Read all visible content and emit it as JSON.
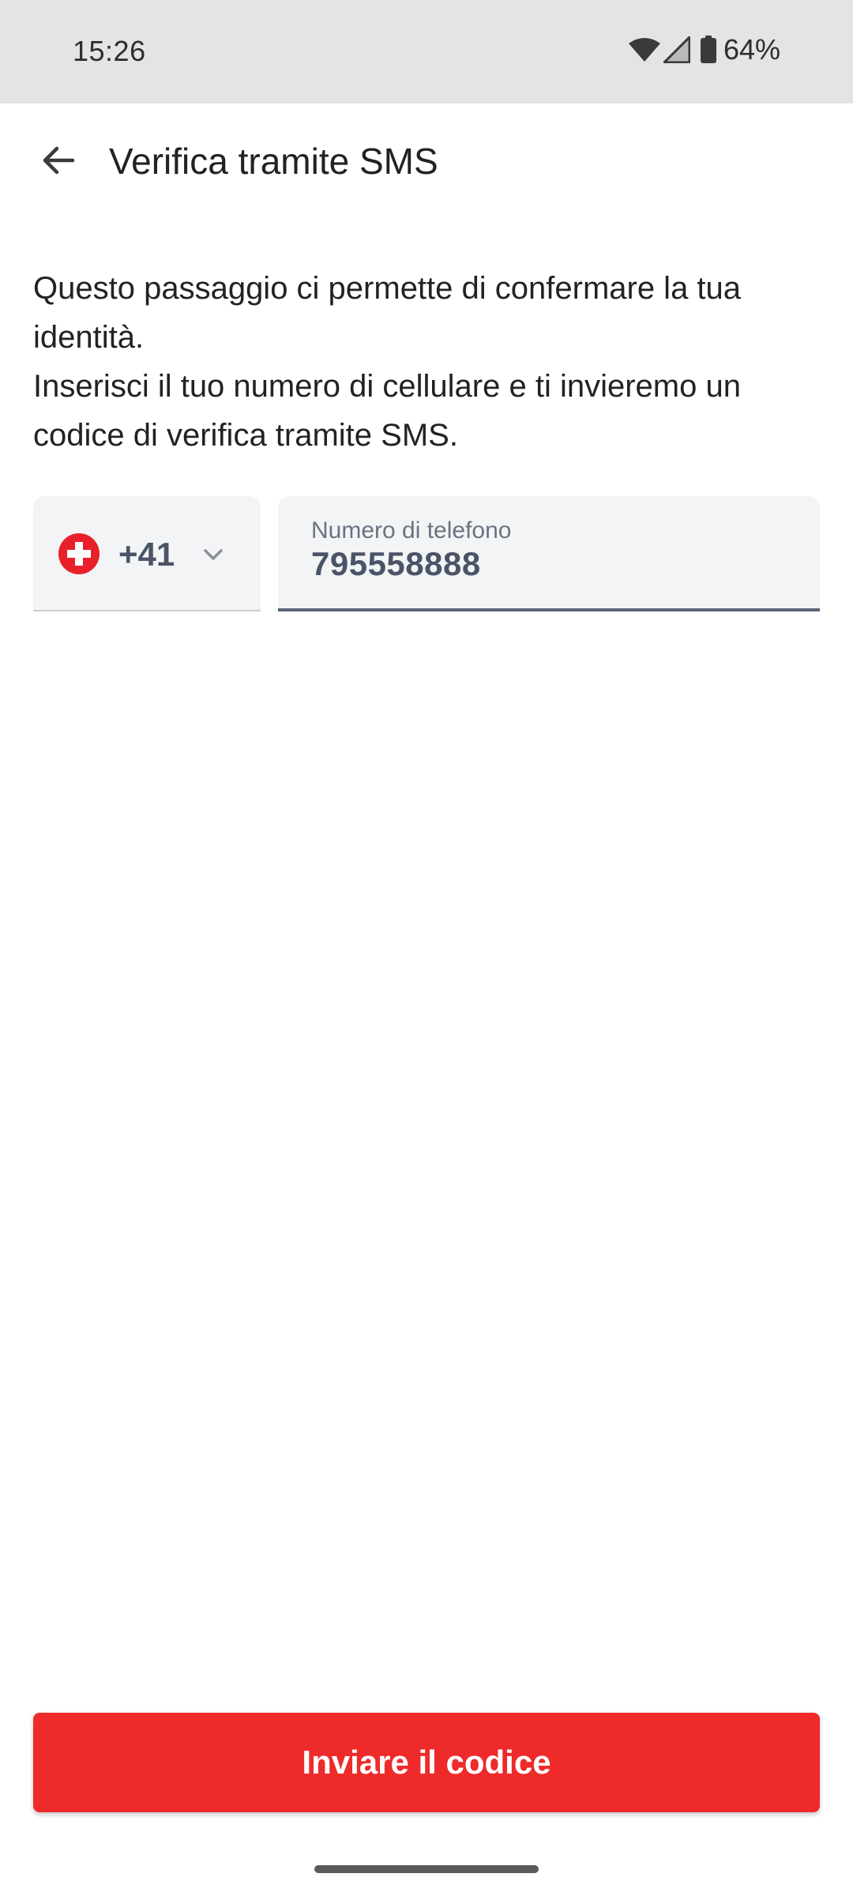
{
  "status_bar": {
    "time": "15:26",
    "battery_percent": "64%",
    "icons": [
      "wifi-icon",
      "signal-icon",
      "battery-icon"
    ]
  },
  "header": {
    "back_icon": "arrow-back-icon",
    "title": "Verifica tramite SMS"
  },
  "main": {
    "description_line1": "Questo passaggio ci permette di confermare la tua identità.",
    "description_line2": "Inserisci il tuo numero di cellulare e ti invieremo un codice di verifica tramite SMS.",
    "country_picker": {
      "flag_icon": "swiss-flag-icon",
      "dial_code": "+41",
      "chevron_icon": "chevron-down-icon"
    },
    "phone_field": {
      "label": "Numero di telefono",
      "value": "795558888"
    }
  },
  "footer": {
    "submit_label": "Inviare il codice"
  },
  "colors": {
    "accent": "#ee2a2a",
    "field_background": "#f3f4f6",
    "field_text": "#4a5466",
    "status_bar": "#e4e4e4"
  }
}
